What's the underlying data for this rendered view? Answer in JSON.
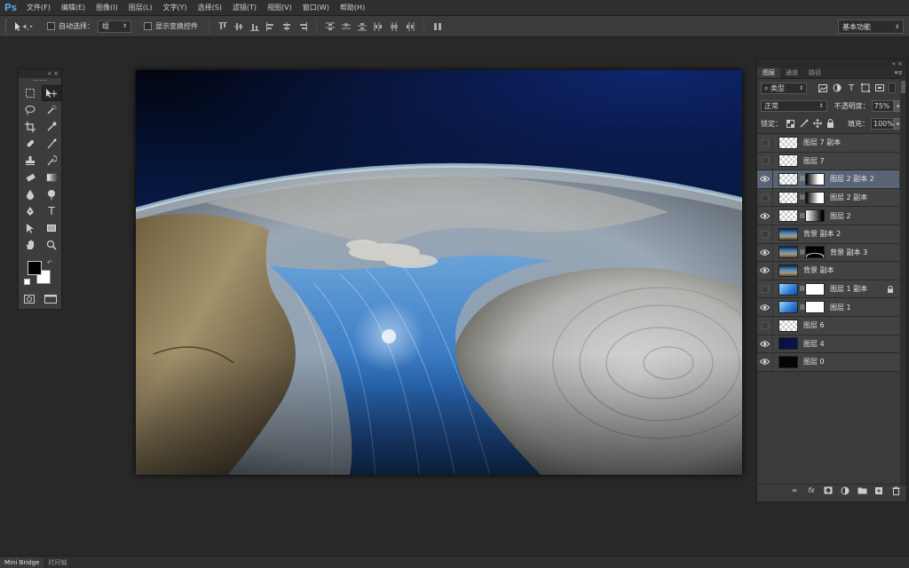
{
  "app": {
    "logo": "Ps"
  },
  "menu": [
    "文件(F)",
    "编辑(E)",
    "图像(I)",
    "图层(L)",
    "文字(Y)",
    "选择(S)",
    "滤镜(T)",
    "视图(V)",
    "窗口(W)",
    "帮助(H)"
  ],
  "options": {
    "auto_select_label": "自动选择：",
    "auto_select_value": "组",
    "show_transform_label": "显示变换控件",
    "workspace": "基本功能"
  },
  "layers_panel": {
    "tabs": [
      "图层",
      "通道",
      "路径"
    ],
    "kind_filter": "类型",
    "blend_mode": "正常",
    "opacity_label": "不透明度：",
    "opacity_value": "75%",
    "lock_label": "锁定：",
    "fill_label": "填充：",
    "fill_value": "100%",
    "layers": [
      {
        "name": "图层 7 副本",
        "visible": false,
        "thumb": "checker",
        "mask": null,
        "selected": false
      },
      {
        "name": "图层 7",
        "visible": false,
        "thumb": "checker",
        "mask": null,
        "selected": false
      },
      {
        "name": "图层 2 副本 2",
        "visible": true,
        "thumb": "checker",
        "mask": "gradient-right",
        "selected": true
      },
      {
        "name": "图层 2 副本",
        "visible": false,
        "thumb": "checker",
        "mask": "gradient-right",
        "selected": false
      },
      {
        "name": "图层 2",
        "visible": true,
        "thumb": "checker",
        "mask": "gradient-left",
        "selected": false
      },
      {
        "name": "背景 副本 2",
        "visible": false,
        "thumb": "photo",
        "mask": null,
        "selected": false
      },
      {
        "name": "背景 副本 3",
        "visible": true,
        "thumb": "photo",
        "mask": "arc",
        "selected": false
      },
      {
        "name": "背景 副本",
        "visible": true,
        "thumb": "photo",
        "mask": null,
        "selected": false
      },
      {
        "name": "图层 1 副本",
        "visible": false,
        "thumb": "blue",
        "mask": "white",
        "selected": false,
        "locked": true
      },
      {
        "name": "图层 1",
        "visible": true,
        "thumb": "blue",
        "mask": "white",
        "selected": false
      },
      {
        "name": "图层 6",
        "visible": false,
        "thumb": "checker",
        "mask": null,
        "selected": false
      },
      {
        "name": "图层 4",
        "visible": true,
        "thumb": "darkblue",
        "mask": null,
        "selected": false
      },
      {
        "name": "图层 0",
        "visible": true,
        "thumb": "black",
        "mask": null,
        "selected": false
      }
    ]
  },
  "bottom_tabs": [
    "Mini Bridge",
    "时间轴"
  ],
  "colors": {
    "accent": "#4aa3df",
    "selected_layer": "#596475",
    "foreground": "#000000",
    "background": "#ffffff"
  }
}
